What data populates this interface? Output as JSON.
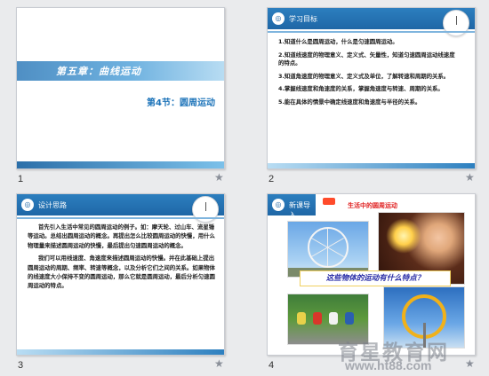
{
  "slides": [
    {
      "number": "1",
      "title": "第五章：曲线运动",
      "subtitle": "第4节：圆周运动"
    },
    {
      "number": "2",
      "header": "学习目标",
      "items": [
        "1.知道什么是圆周运动，什么是匀速圆周运动。",
        "2.知道线速度的物理意义、定义式、矢量性，知道匀速圆周运动线速度的特点。",
        "3.知道角速度的物理意义、定义式及单位，了解转速和周期的关系。",
        "4.掌握线速度和角速度的关系，掌握角速度与转速、周期的关系。",
        "5.能在具体的情景中确定线速度和角速度与半径的关系。"
      ]
    },
    {
      "number": "3",
      "header": "设计思路",
      "paragraphs": [
        "首先引入生活中常见的圆周运动的例子。如：摩天轮、过山车、流星锤等运动。总结出圆周运动的概念。再提出怎么比较圆周运动的快慢，用什么物理量来描述圆周运动的快慢，最后提出匀速圆周运动的概念。",
        "我们可以用线速度、角速度来描述圆周运动的快慢。并在此基础上提出圆周运动的周期、频率、转速等概念，以及分析它们之间的关系。如果物体的线速度大小保持不变的圆周运动，那么它就是圆周运动，最后分析匀速圆周运动的特点。"
      ]
    },
    {
      "number": "4",
      "header": "新课导入",
      "red_caption": "生活中的圆周运动",
      "question": "这些物体的运动有什么特点？"
    }
  ],
  "watermark": {
    "site_name": "育星教育网",
    "url": "www.ht88.com"
  }
}
